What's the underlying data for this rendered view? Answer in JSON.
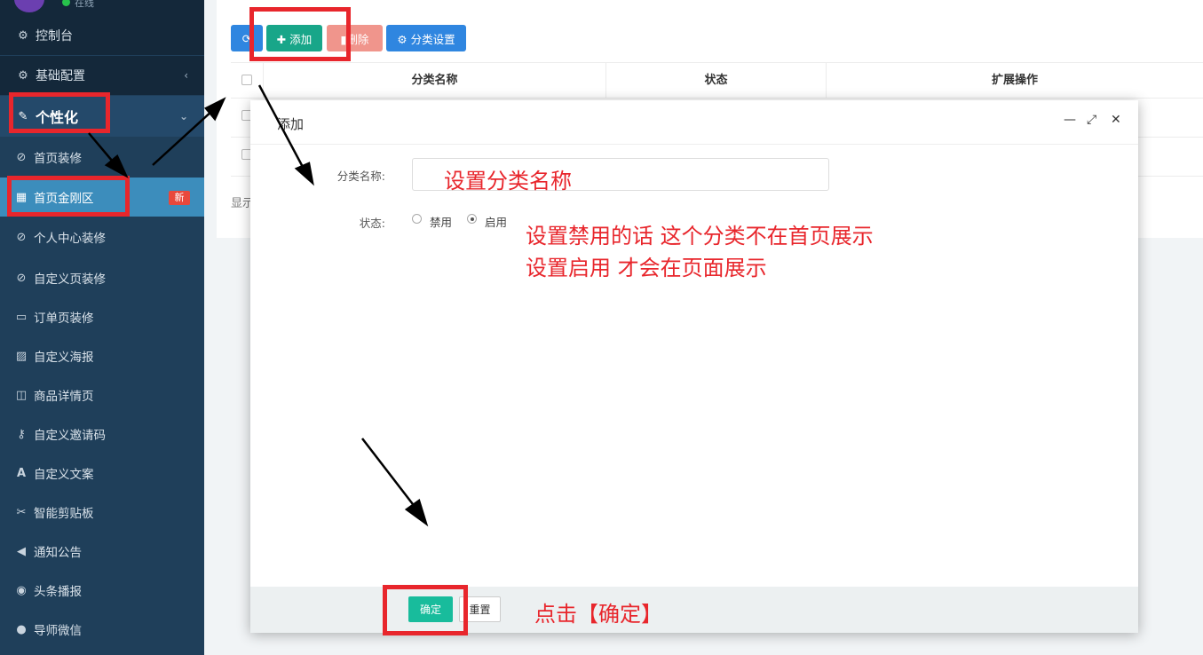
{
  "sidebar": {
    "status_text": "在线",
    "items": [
      {
        "label": "控制台",
        "icon": "dashboard-icon",
        "glyph": "⚙"
      },
      {
        "label": "基础配置",
        "icon": "cogs-icon",
        "glyph": "⚙"
      },
      {
        "label": "个性化",
        "icon": "magic-wand-icon",
        "glyph": "✎"
      },
      {
        "label": "首页装修",
        "icon": "paint-icon",
        "glyph": "⊘"
      },
      {
        "label": "首页金刚区",
        "icon": "grid-icon",
        "glyph": "▦"
      },
      {
        "label": "个人中心装修",
        "icon": "paint-icon",
        "glyph": "⊘"
      },
      {
        "label": "自定义页装修",
        "icon": "paint-icon",
        "glyph": "⊘"
      },
      {
        "label": "订单页装修",
        "icon": "window-icon",
        "glyph": "▭"
      },
      {
        "label": "自定义海报",
        "icon": "image-icon",
        "glyph": "▨"
      },
      {
        "label": "商品详情页",
        "icon": "columns-icon",
        "glyph": "◫"
      },
      {
        "label": "自定义邀请码",
        "icon": "key-icon",
        "glyph": "⚷"
      },
      {
        "label": "自定义文案",
        "icon": "font-icon",
        "glyph": "A"
      },
      {
        "label": "智能剪贴板",
        "icon": "scissors-icon",
        "glyph": "✂"
      },
      {
        "label": "通知公告",
        "icon": "bullhorn-icon",
        "glyph": "◀"
      },
      {
        "label": "头条播报",
        "icon": "podcast-icon",
        "glyph": "◉"
      },
      {
        "label": "导师微信",
        "icon": "wechat-icon",
        "glyph": "●"
      }
    ],
    "badge_new": "新"
  },
  "toolbar": {
    "refresh_glyph": "⟳",
    "add_label": "✚ 添加",
    "delete_label": "▮删除",
    "category_settings_label": "⚙ 分类设置"
  },
  "table": {
    "columns": [
      "分类名称",
      "状态",
      "扩展操作"
    ],
    "footer_text": "显示"
  },
  "modal": {
    "title": "添加",
    "minimize_glyph": "—",
    "maximize_glyph": "⤢",
    "close_glyph": "✕",
    "name_label": "分类名称:",
    "name_value": "",
    "status_label": "状态:",
    "status_options": [
      "禁用",
      "启用"
    ],
    "status_selected": "启用",
    "ok_label": "确定",
    "reset_label": "重置"
  },
  "annotations": {
    "hint_name": "设置分类名称",
    "hint_status_1": "设置禁用的话 这个分类不在首页展示",
    "hint_status_2": "设置启用  才会在页面展示",
    "hint_ok": "点击【确定】",
    "color": "#e8262c"
  }
}
